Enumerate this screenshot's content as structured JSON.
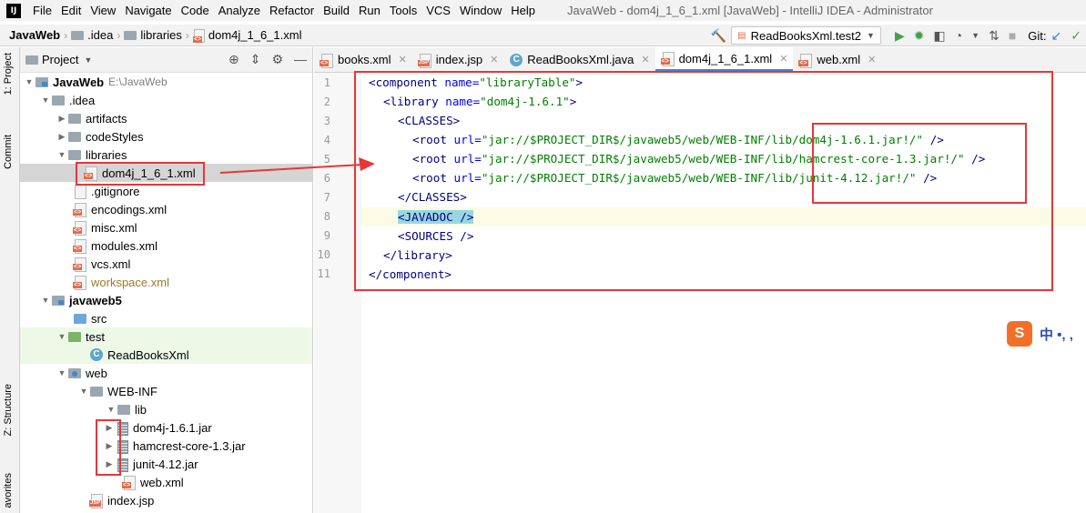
{
  "menubar": {
    "items": [
      "File",
      "Edit",
      "View",
      "Navigate",
      "Code",
      "Analyze",
      "Refactor",
      "Build",
      "Run",
      "Tools",
      "VCS",
      "Window",
      "Help"
    ],
    "window_title": "JavaWeb - dom4j_1_6_1.xml [JavaWeb] - IntelliJ IDEA - Administrator"
  },
  "navbar": {
    "breadcrumbs": [
      "JavaWeb",
      ".idea",
      "libraries",
      "dom4j_1_6_1.xml"
    ],
    "run_config": "ReadBooksXml.test2",
    "git_label": "Git:"
  },
  "left_strip": {
    "project_tab": "1: Project",
    "commit_tab": "Commit",
    "structure_tab": "Z: Structure",
    "favorites_tab": "avorites"
  },
  "project_panel": {
    "title": "Project",
    "tree": [
      {
        "label": "JavaWeb",
        "path": "E:\\JavaWeb"
      },
      {
        "label": ".idea"
      },
      {
        "label": "artifacts"
      },
      {
        "label": "codeStyles"
      },
      {
        "label": "libraries"
      },
      {
        "label": "dom4j_1_6_1.xml"
      },
      {
        "label": ".gitignore"
      },
      {
        "label": "encodings.xml"
      },
      {
        "label": "misc.xml"
      },
      {
        "label": "modules.xml"
      },
      {
        "label": "vcs.xml"
      },
      {
        "label": "workspace.xml"
      },
      {
        "label": "javaweb5"
      },
      {
        "label": "src"
      },
      {
        "label": "test"
      },
      {
        "label": "ReadBooksXml"
      },
      {
        "label": "web"
      },
      {
        "label": "WEB-INF"
      },
      {
        "label": "lib"
      },
      {
        "label": "dom4j-1.6.1.jar"
      },
      {
        "label": "hamcrest-core-1.3.jar"
      },
      {
        "label": "junit-4.12.jar"
      },
      {
        "label": "web.xml"
      },
      {
        "label": "index.jsp"
      }
    ]
  },
  "tabs": [
    {
      "label": "books.xml"
    },
    {
      "label": "index.jsp"
    },
    {
      "label": "ReadBooksXml.java"
    },
    {
      "label": "dom4j_1_6_1.xml"
    },
    {
      "label": "web.xml"
    }
  ],
  "editor": {
    "line_numbers": [
      "1",
      "2",
      "3",
      "4",
      "5",
      "6",
      "7",
      "8",
      "9",
      "10",
      "11"
    ],
    "lines": {
      "l1": {
        "open": "<component ",
        "attr": "name=",
        "val": "\"libraryTable\"",
        "close": ">"
      },
      "l2": {
        "open": "<library ",
        "attr": "name=",
        "val": "\"dom4j-1.6.1\"",
        "close": ">"
      },
      "l3": {
        "tag": "<CLASSES>"
      },
      "l4": {
        "open": "<root ",
        "attr": "url=",
        "val": "\"jar://$PROJECT_DIR$/javaweb5/web/WEB-INF/lib/dom4j-1.6.1.jar!/\"",
        "close": " />"
      },
      "l5": {
        "open": "<root ",
        "attr": "url=",
        "val": "\"jar://$PROJECT_DIR$/javaweb5/web/WEB-INF/lib/hamcrest-core-1.3.jar!/\"",
        "close": " />"
      },
      "l6": {
        "open": "<root ",
        "attr": "url=",
        "val": "\"jar://$PROJECT_DIR$/javaweb5/web/WEB-INF/lib/junit-4.12.jar!/\"",
        "close": " />"
      },
      "l7": {
        "tag": "</CLASSES>"
      },
      "l8": {
        "open": "<JAVADOC ",
        "close": "/>"
      },
      "l9": {
        "tag": "<SOURCES />"
      },
      "l10": {
        "tag": "</library>"
      },
      "l11": {
        "tag": "</component>"
      }
    }
  },
  "ime": {
    "logo": "S",
    "text": "中 •, ,"
  },
  "colors": {
    "annotation_red": "#e83636",
    "tab_underline": "#4083c9",
    "tag": "#000080",
    "attr": "#0000ff",
    "value": "#008000"
  }
}
